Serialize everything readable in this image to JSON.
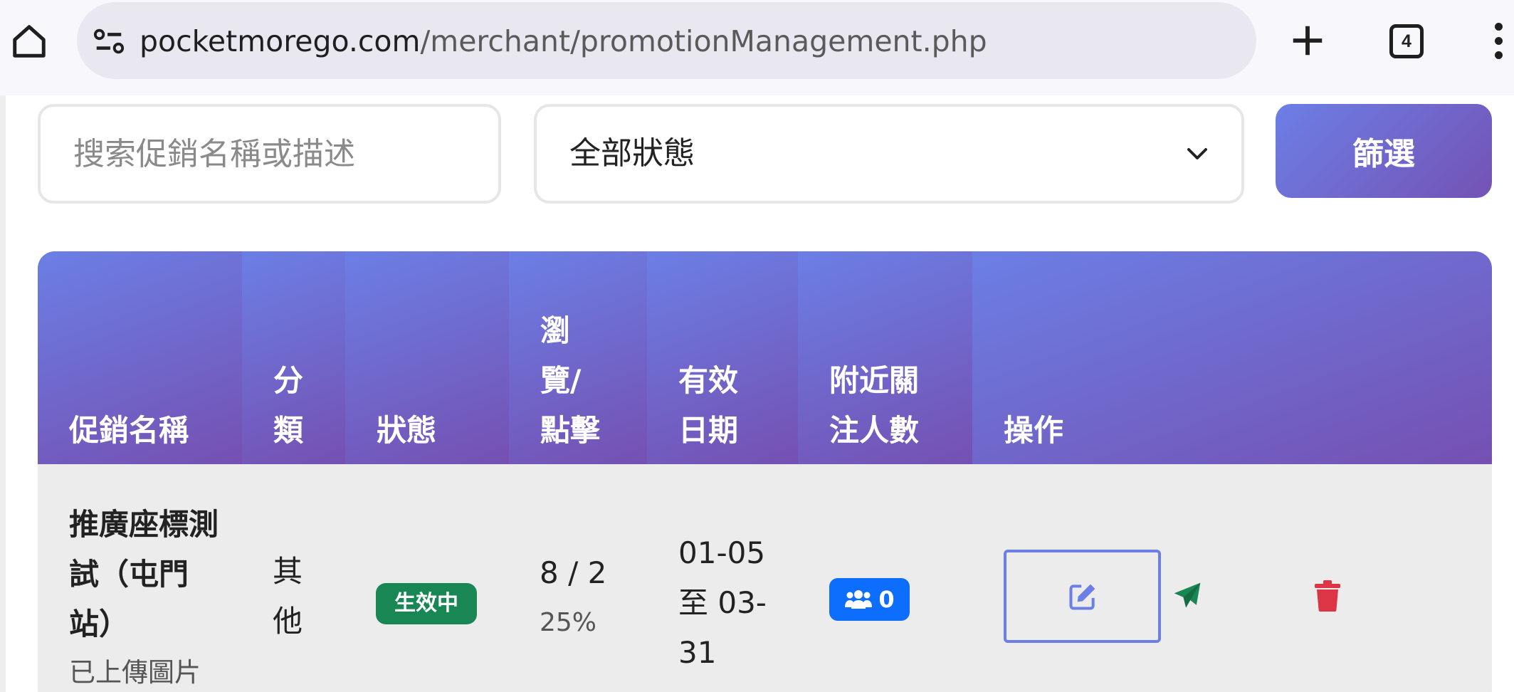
{
  "browser": {
    "url_domain": "pocketmorego.com",
    "url_path": "/merchant/promotionManagement.php",
    "tab_count": "4"
  },
  "filters": {
    "search_placeholder": "搜索促銷名稱或描述",
    "status_value": "全部狀態",
    "filter_button": "篩選"
  },
  "table": {
    "headers": [
      "促銷名稱",
      "分\n類",
      "狀態",
      "瀏\n覽/\n點擊",
      "有效\n日期",
      "附近關\n注人數",
      "操作"
    ],
    "rows": [
      {
        "name": "推廣座標測試（屯門站）",
        "subtext": "已上傳圖片",
        "category": "其他",
        "status": "生效中",
        "views_clicks": "8 / 2",
        "ctr": "25%",
        "dates": "01-05 至 03-31",
        "followers": "0"
      }
    ]
  },
  "colors": {
    "accent_start": "#6c7fe6",
    "accent_end": "#7452b4",
    "status_active": "#198754",
    "followers_badge": "#0d6efd",
    "send_icon": "#198754",
    "delete_icon": "#dc3545"
  }
}
